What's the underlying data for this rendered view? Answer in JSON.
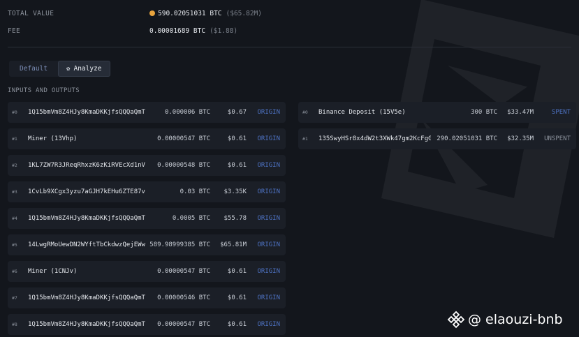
{
  "summary": {
    "total_value_label": "TOTAL VALUE",
    "total_value_btc": "590.02051031 BTC",
    "total_value_fiat": "($65.82M)",
    "fee_label": "FEE",
    "fee_btc": "0.00001689 BTC",
    "fee_fiat": "($1.88)"
  },
  "tabs": [
    {
      "label": "Default",
      "active": false
    },
    {
      "label": "Analyze",
      "active": true
    }
  ],
  "section_title": "INPUTS AND OUTPUTS",
  "inputs": [
    {
      "index": "#0",
      "address": "1Q15bmVm8Z4HJy8KmaDKKjfsQQQaQmT…",
      "amount": "0.000006 BTC",
      "fiat": "$0.67",
      "action": "ORIGIN"
    },
    {
      "index": "#1",
      "address": "Miner (13Vhp)",
      "amount": "0.00000547 BTC",
      "fiat": "$0.61",
      "action": "ORIGIN"
    },
    {
      "index": "#2",
      "address": "1KL7ZW7R3JReqRhxzK6zKiRVEcXd1nV…",
      "amount": "0.00000548 BTC",
      "fiat": "$0.61",
      "action": "ORIGIN"
    },
    {
      "index": "#3",
      "address": "1CvLb9XCgx3yzu7aGJH7kEHu6ZTE87v…",
      "amount": "0.03 BTC",
      "fiat": "$3.35K",
      "action": "ORIGIN"
    },
    {
      "index": "#4",
      "address": "1Q15bmVm8Z4HJy8KmaDKKjfsQQQaQmT…",
      "amount": "0.0005 BTC",
      "fiat": "$55.78",
      "action": "ORIGIN"
    },
    {
      "index": "#5",
      "address": "14LwgRMoUewDN2WYftTbCkdwzQejEWw…",
      "amount": "589.98999385 BTC",
      "fiat": "$65.81M",
      "action": "ORIGIN"
    },
    {
      "index": "#6",
      "address": "Miner (1CNJv)",
      "amount": "0.00000547 BTC",
      "fiat": "$0.61",
      "action": "ORIGIN"
    },
    {
      "index": "#7",
      "address": "1Q15bmVm8Z4HJy8KmaDKKjfsQQQaQmT…",
      "amount": "0.00000546 BTC",
      "fiat": "$0.61",
      "action": "ORIGIN"
    },
    {
      "index": "#8",
      "address": "1Q15bmVm8Z4HJy8KmaDKKjfsQQQaQmT…",
      "amount": "0.00000547 BTC",
      "fiat": "$0.61",
      "action": "ORIGIN"
    }
  ],
  "outputs": [
    {
      "index": "#0",
      "address": "Binance Deposit (15V5e)",
      "amount": "300 BTC",
      "fiat": "$33.47M",
      "status": "SPENT"
    },
    {
      "index": "#1",
      "address": "135SwyHSr8x4dW2t3XWk47gm2KcFgG…",
      "amount": "290.02051031 BTC",
      "fiat": "$32.35M",
      "status": "UNSPENT"
    }
  ],
  "watermark": {
    "text": "@ elaouzi-bnb",
    "icon": "binance-diamond-icon"
  },
  "colors": {
    "background": "#13161c",
    "row": "#1b1f27",
    "link": "#4e73c4",
    "coin": "#e8a33d"
  }
}
